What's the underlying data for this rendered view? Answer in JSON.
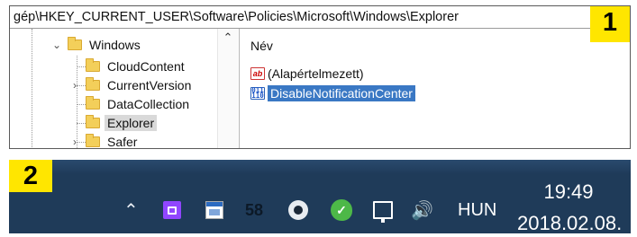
{
  "panel1": {
    "badge": "1",
    "address": "gép\\HKEY_CURRENT_USER\\Software\\Policies\\Microsoft\\Windows\\Explorer",
    "tree": {
      "parent": "Windows",
      "children": [
        "CloudContent",
        "CurrentVersion",
        "DataCollection",
        "Explorer",
        "Safer"
      ],
      "selected": "Explorer"
    },
    "values": {
      "column_header": "Név",
      "items": [
        {
          "icon": "string-value-icon",
          "icon_text": "ab",
          "name": "(Alapértelmezett)"
        },
        {
          "icon": "dword-value-icon",
          "icon_text": "011 110",
          "name": "DisableNotificationCenter",
          "selected": true
        }
      ]
    }
  },
  "panel2": {
    "badge": "2",
    "tray": {
      "app_count": "58",
      "language": "HUN"
    },
    "clock": {
      "time": "19:49",
      "date": "2018.02.08."
    }
  },
  "colors": {
    "badge": "#ffe600",
    "taskbar": "#1f3b59",
    "selection": "#3a78c4",
    "folder": "#f3cf5a"
  }
}
